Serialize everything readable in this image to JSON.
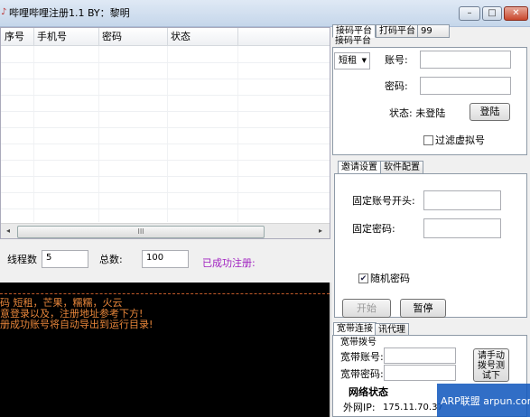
{
  "window": {
    "title": "哔哩哔哩注册1.1   BY：黎明",
    "minimize_glyph": "–",
    "maximize_glyph": "□",
    "close_glyph": "✕"
  },
  "table": {
    "columns": [
      "序号",
      "手机号",
      "密码",
      "状态"
    ],
    "scroll_left": "◂",
    "scroll_right": "▸",
    "scroll_thumb": "III"
  },
  "controls": {
    "threads_label": "线程数",
    "threads_value": "5",
    "total_label": "总数:",
    "total_value": "100",
    "success_label": "已成功注册:"
  },
  "console": {
    "lines": [
      "码  短租，芒果，糯糯，火云",
      "意登录以及，注册地址参考下方!",
      "册成功账号将自动导出到运行目录!"
    ]
  },
  "right": {
    "top_tabs": [
      "接码平台",
      "打码平台",
      "99"
    ],
    "second_tab": "接码平台",
    "platform_select": "短租",
    "account_label": "账号:",
    "password_label": "密码:",
    "status_label": "状态: 未登陆",
    "login_button": "登陆",
    "filter_virtual": "过滤虚拟号",
    "middle_tabs": [
      "邀请设置",
      "软件配置"
    ],
    "fixed_prefix_label": "固定账号开头:",
    "fixed_password_label": "固定密码:",
    "random_password": "随机密码",
    "start_button": "开始",
    "pause_button": "暂停",
    "bottom_tabs": [
      "宽带连接",
      "讯代理"
    ],
    "broadband_group": "宽带拨号",
    "broadband_account_label": "宽带账号:",
    "broadband_password_label": "宽带密码:",
    "manual_dial_button": [
      "请手动",
      "拨号测",
      "试下"
    ],
    "network_status": "网络状态",
    "wan_ip_label": "外网IP:",
    "wan_ip_value": "175.11.70.37"
  },
  "watermark": {
    "text": "ARP联盟 arpun.com"
  },
  "colors": {
    "console_bg": "#000000",
    "console_text": "#e8863a",
    "success_label": "#a020c0",
    "watermark_bg": "#1f5fbf"
  }
}
